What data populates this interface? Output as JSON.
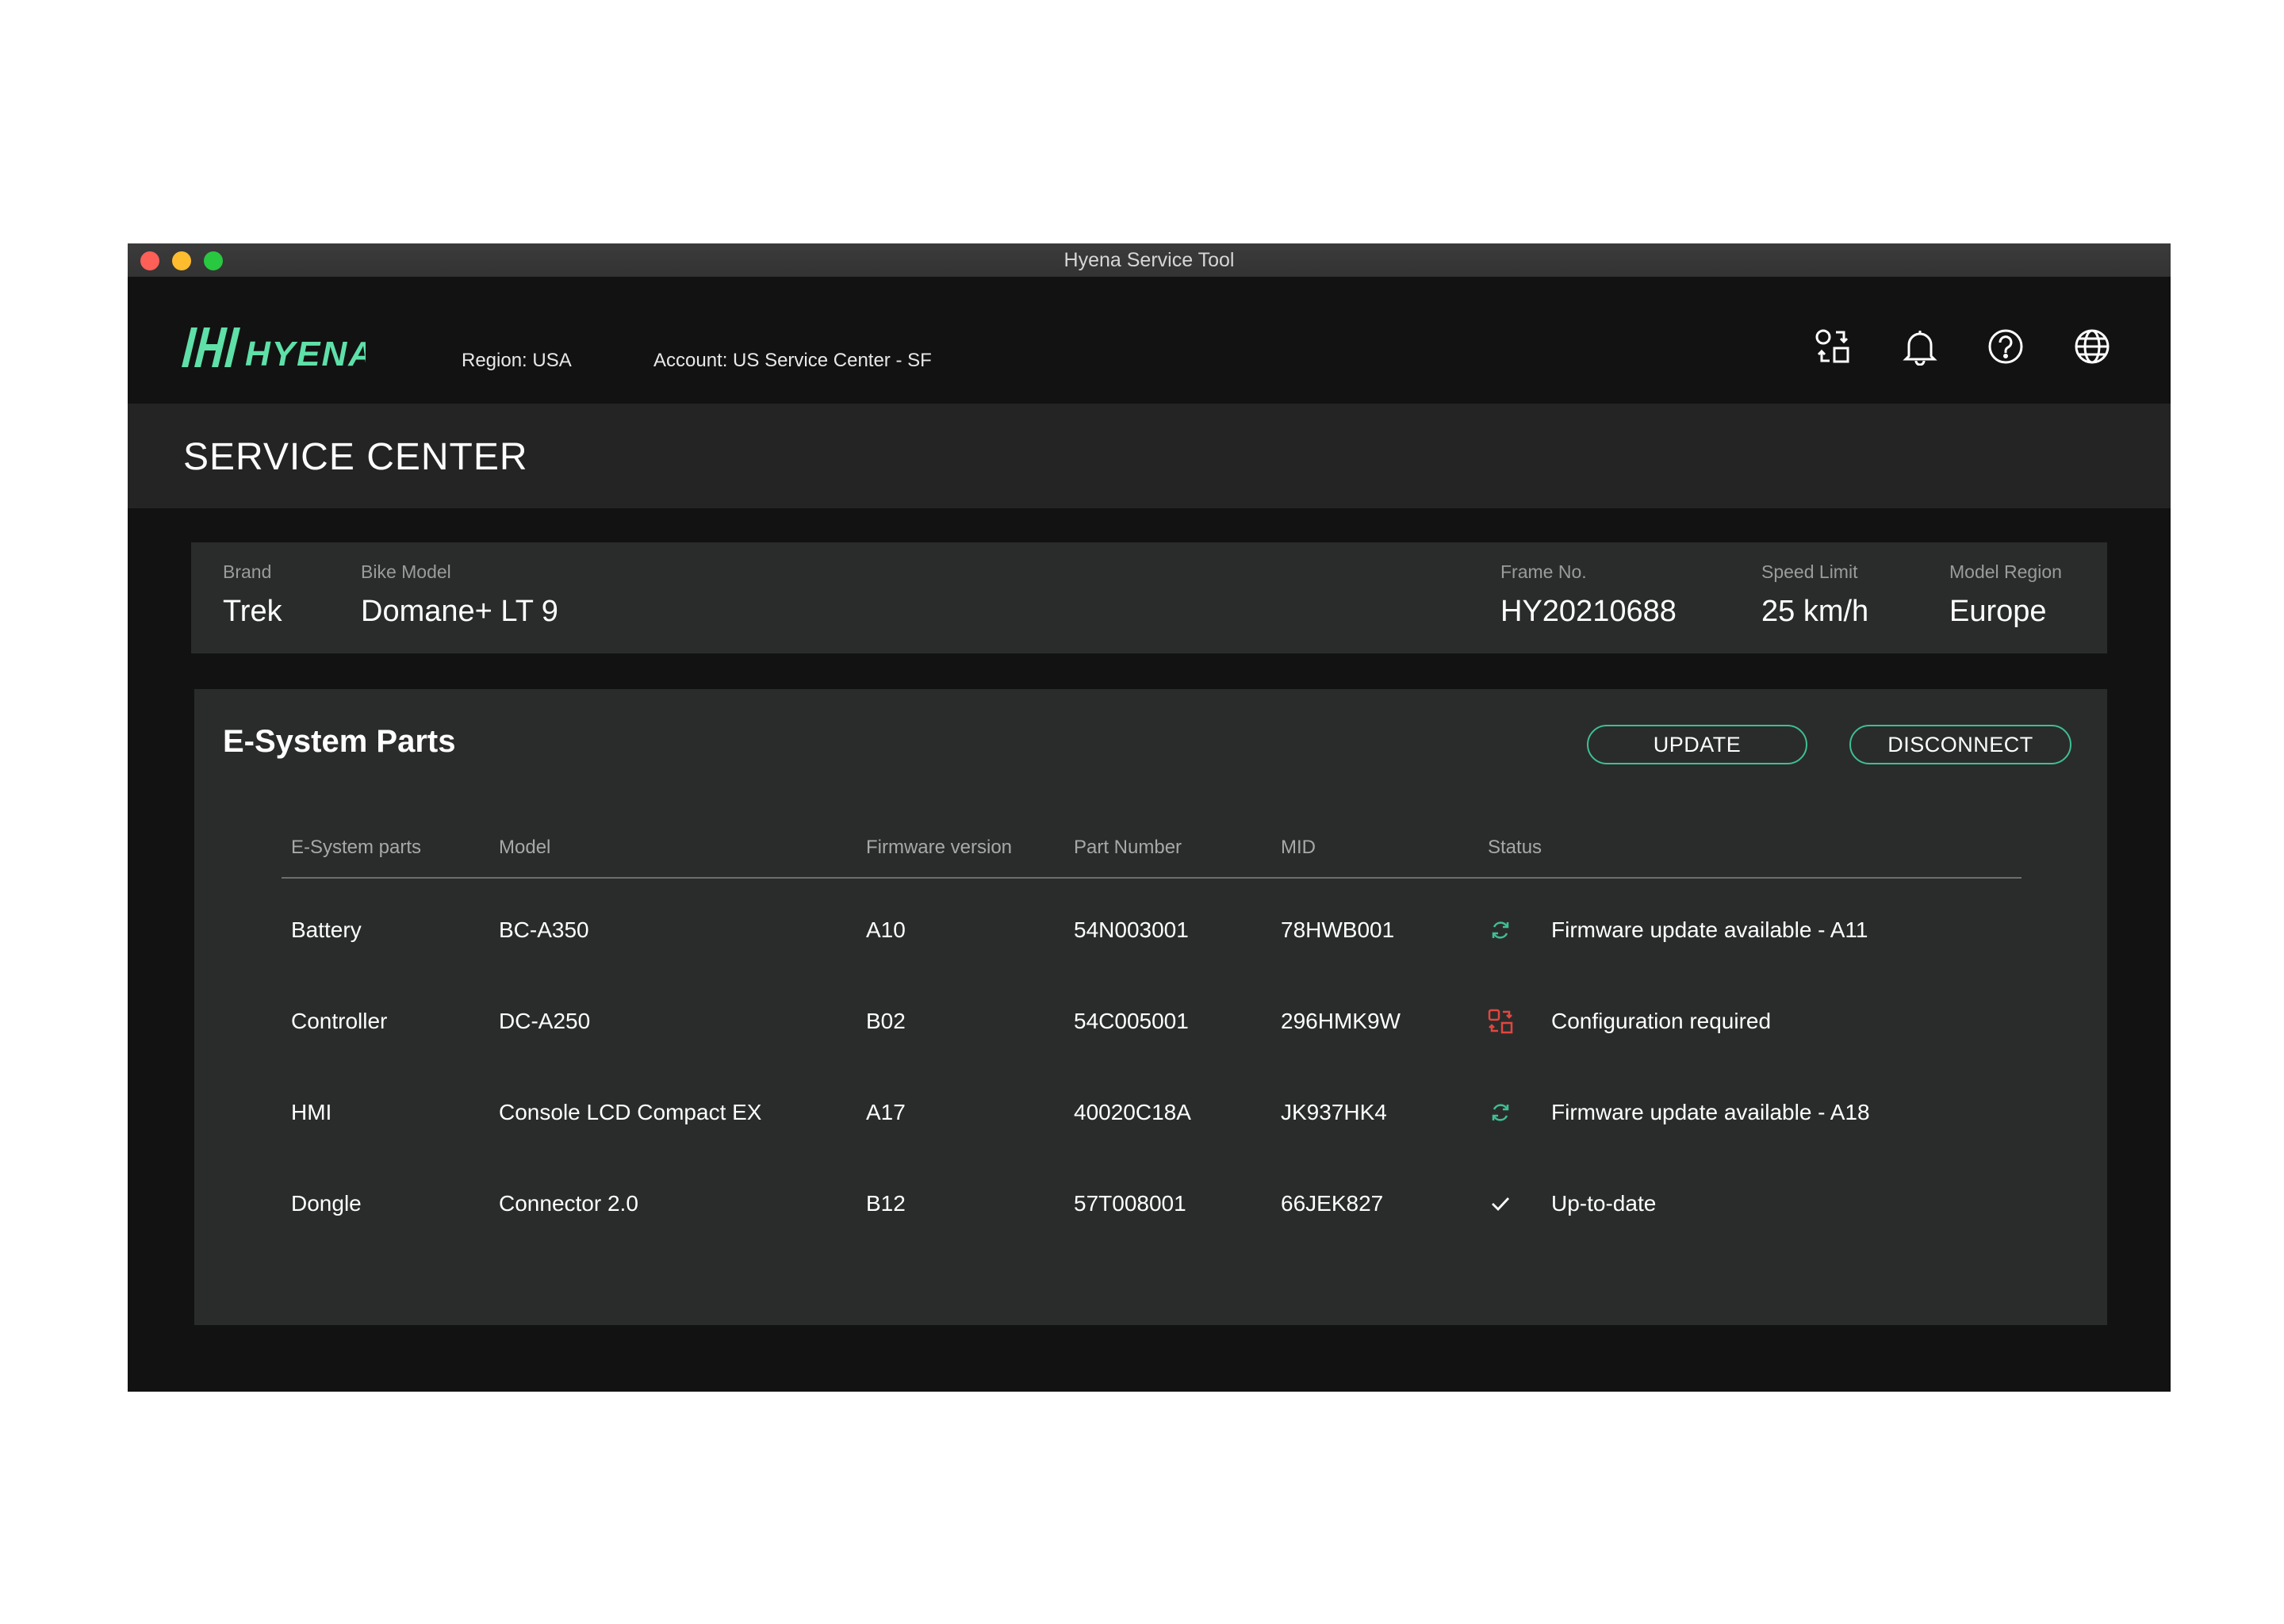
{
  "window": {
    "title": "Hyena Service Tool"
  },
  "header": {
    "logo_text": "HYENA",
    "region": "Region: USA",
    "account": "Account: US Service Center - SF",
    "icons": [
      "device-swap-icon",
      "bell-icon",
      "help-icon",
      "globe-icon"
    ]
  },
  "page": {
    "title": "SERVICE CENTER"
  },
  "bike": {
    "brand_label": "Brand",
    "brand": "Trek",
    "model_label": "Bike Model",
    "model": "Domane+ LT 9",
    "frame_label": "Frame No.",
    "frame": "HY20210688",
    "speed_label": "Speed Limit",
    "speed": "25 km/h",
    "region_label": "Model Region",
    "region": "Europe"
  },
  "parts": {
    "title": "E-System Parts",
    "update_label": "UPDATE",
    "disconnect_label": "DISCONNECT",
    "columns": [
      "E-System parts",
      "Model",
      "Firmware version",
      "Part Number",
      "MID",
      "Status"
    ],
    "rows": [
      {
        "part": "Battery",
        "model": "BC-A350",
        "firmware": "A10",
        "part_number": "54N003001",
        "mid": "78HWB001",
        "status": "Firmware update available - A11",
        "status_icon": "refresh-icon"
      },
      {
        "part": "Controller",
        "model": "DC-A250",
        "firmware": "B02",
        "part_number": "54C005001",
        "mid": "296HMK9W",
        "status": "Configuration required",
        "status_icon": "config-icon"
      },
      {
        "part": "HMI",
        "model": "Console LCD Compact EX",
        "firmware": "A17",
        "part_number": "40020C18A",
        "mid": "JK937HK4",
        "status": "Firmware update available - A18",
        "status_icon": "refresh-icon"
      },
      {
        "part": "Dongle",
        "model": "Connector 2.0",
        "firmware": "B12",
        "part_number": "57T008001",
        "mid": "66JEK827",
        "status": "Up-to-date",
        "status_icon": "check-icon"
      }
    ]
  },
  "colors": {
    "accent": "#3fbf91",
    "logo": "#5ee0a8",
    "alert": "#e2473d",
    "background": "#121212",
    "card": "#2a2c2c"
  }
}
